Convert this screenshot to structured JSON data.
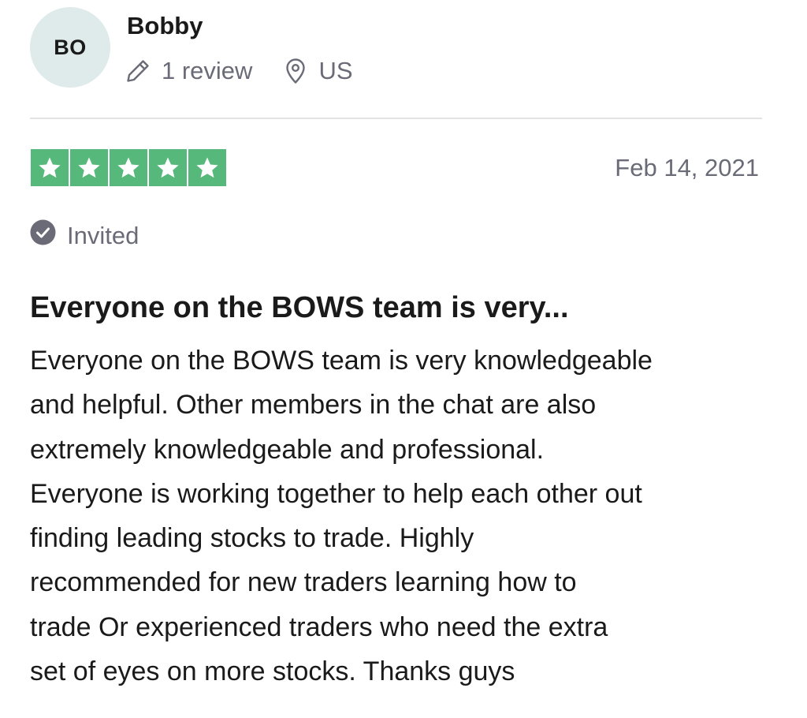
{
  "reviewer": {
    "initials": "BO",
    "name": "Bobby",
    "review_count": "1 review",
    "country": "US",
    "avatar_color": "#dfeaea"
  },
  "rating": {
    "stars": 5,
    "max_stars": 5,
    "star_color": "#57b87b",
    "date": "Feb 14, 2021"
  },
  "verification": {
    "label": "Invited",
    "icon": "check-circle-icon"
  },
  "review": {
    "title": "Everyone on the BOWS team is very...",
    "body_lines": [
      "Everyone on the BOWS team is very knowledgeable",
      "and helpful. Other members in the chat are also",
      "extremely knowledgeable and professional.",
      "Everyone is working together to help each other out",
      "finding leading stocks to trade. Highly",
      "recommended for new traders learning how to",
      "trade Or experienced traders who need the extra",
      "set of eyes on more stocks. Thanks guys"
    ]
  },
  "icons": {
    "review_count": "pencil-icon",
    "location": "location-pin-icon",
    "star": "star-icon"
  },
  "colors": {
    "muted_text": "#6b6b78",
    "primary_text": "#1a1a1a",
    "divider": "#e3e3e3"
  }
}
